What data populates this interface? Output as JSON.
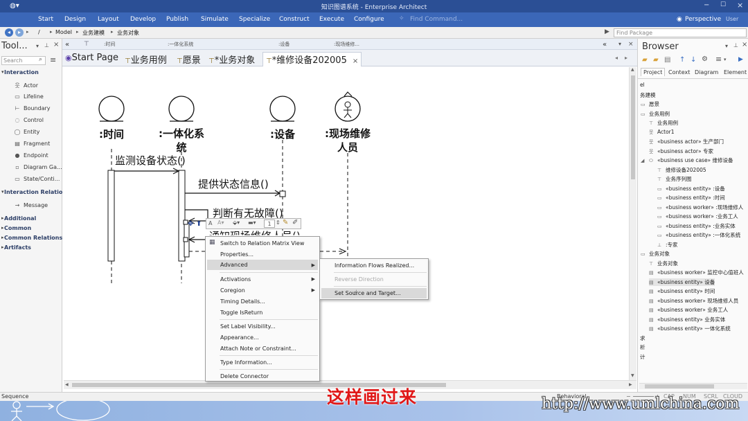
{
  "app": {
    "title": "知识图谱系统 - Enterprise Architect",
    "menu": [
      "Start",
      "Design",
      "Layout",
      "Develop",
      "Publish",
      "Simulate",
      "Specialize",
      "Construct",
      "Execute",
      "Configure"
    ],
    "command_placeholder": "Find Command...",
    "perspective": "Perspective",
    "user": "User"
  },
  "nav": {
    "path": [
      "/",
      "Model",
      "业务建模",
      "业务对象"
    ],
    "find_package_placeholder": "Find Package"
  },
  "toolbox": {
    "title": "Tool...",
    "search_placeholder": "Search",
    "sections": [
      {
        "name": "Interaction",
        "items": [
          "Actor",
          "Lifeline",
          "Boundary",
          "Control",
          "Entity",
          "Fragment",
          "Endpoint",
          "Diagram Ga...",
          "State/Conti..."
        ]
      },
      {
        "name": "Interaction Relatio",
        "items": [
          "Message"
        ]
      },
      {
        "name": "Additional",
        "items": []
      },
      {
        "name": "Common",
        "items": []
      },
      {
        "name": "Common Relations",
        "items": []
      },
      {
        "name": "Artifacts",
        "items": []
      }
    ]
  },
  "subtabs": [
    ":时间",
    ":一体化系统",
    ":设备",
    ":现场维修..."
  ],
  "doc_tabs": [
    "Start Page",
    "业务用例",
    "愿景",
    "*业务对象",
    "*维修设备202005"
  ],
  "diagram": {
    "lifelines": [
      ":时间",
      ":一体化系统",
      ":设备",
      ":现场维修人员"
    ],
    "lifeline_2_lines": [
      ":一体化系",
      "统"
    ],
    "lifeline_4_lines": [
      ":现场维修",
      "人员"
    ],
    "messages": [
      "监测设备状态()",
      "提供状态信息()",
      "判断有无故障()",
      "通知现场维修人员()"
    ]
  },
  "floating_toolbar": {
    "line_width": "1"
  },
  "context_menu": {
    "items": [
      "Switch to Relation Matrix View",
      "Properties...",
      "Advanced",
      "Activations",
      "Coregion",
      "Timing Details...",
      "Toggle IsReturn",
      "Set Label Visibility...",
      "Appearance...",
      "Attach Note or Constraint...",
      "Type Information...",
      "Delete Connector"
    ],
    "submenu": [
      "Information Flows Realized...",
      "Reverse Direction",
      "Set Source and Target..."
    ]
  },
  "browser": {
    "title": "Browser",
    "tabs": [
      "Project",
      "Context",
      "Diagram",
      "Element"
    ],
    "tree": [
      "el",
      "务建模",
      "愿景",
      "业务用例",
      "业务用例",
      "Actor1",
      "«business actor» 生产部门",
      "«business actor» 专家",
      "«business use case» 维修设备",
      "维修设备202005",
      "业务序列图",
      "«business entity» :设备",
      "«business entity» :时间",
      "«business worker» :现场维修人",
      "«business worker» :业务工人",
      "«business entity» :业务实体",
      "«business entity» :一体化系统",
      ":专家",
      "业务对象",
      "业务对象",
      "«business worker» 监控中心值班人",
      "«business entity» 设备",
      "«business entity» 时间",
      "«business worker» 现场维修人员",
      "«business worker» 业务工人",
      "«business entity» 业务实体",
      "«business entity» 一体化系统",
      "求",
      "析",
      "计"
    ]
  },
  "status": {
    "left": "Sequence",
    "mode": "Behavioral",
    "flags": [
      "CAP",
      "NUM",
      "SCRL",
      "CLOUD"
    ]
  },
  "overlay": {
    "subtitle": "这样画过来",
    "watermark": "http://www.umlchina.com"
  }
}
